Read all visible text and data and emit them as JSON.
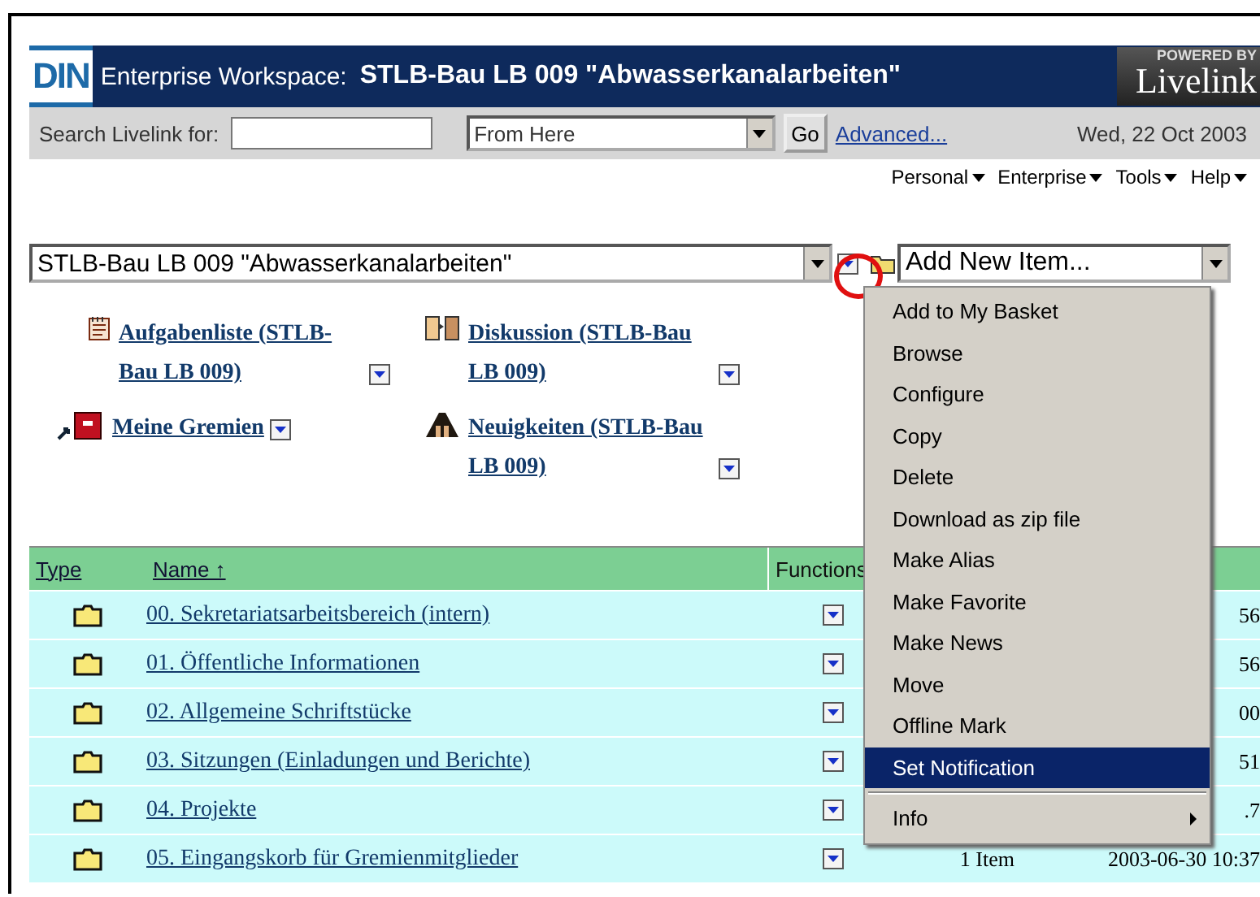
{
  "header": {
    "logo": "DIN",
    "label": "Enterprise Workspace:",
    "title": "STLB-Bau LB 009 \"Abwasserkanalarbeiten\"",
    "badge_top": "POWERED BY",
    "badge_main": "Livelink"
  },
  "search": {
    "label": "Search Livelink for:",
    "scope": "From Here",
    "go": "Go",
    "advanced": "Advanced...",
    "date": "Wed, 22 Oct 2003"
  },
  "menus": [
    "Personal",
    "Enterprise",
    "Tools",
    "Help"
  ],
  "location": {
    "value": "STLB-Bau LB 009 \"Abwasserkanalarbeiten\"",
    "add_item": "Add New Item..."
  },
  "links": [
    {
      "kind": "tasks",
      "text": "Aufgabenliste (STLB-Bau LB 009)"
    },
    {
      "kind": "discussion",
      "text": "Diskussion (STLB-Bau LB 009)"
    },
    {
      "kind": "alias",
      "text": "Meine Gremien"
    },
    {
      "kind": "news",
      "text": "Neuigkeiten (STLB-Bau LB 009)"
    }
  ],
  "table": {
    "columns": [
      {
        "label": "Type",
        "link": true
      },
      {
        "label": "Name ↑",
        "link": true
      },
      {
        "label": "Functions",
        "link": false
      }
    ],
    "rows": [
      {
        "name": "00. Sekretariatsarbeitsbereich (intern)",
        "size": "",
        "modified": "56"
      },
      {
        "name": "01. Öffentliche Informationen",
        "size": "",
        "modified": "56"
      },
      {
        "name": "02. Allgemeine Schriftstücke",
        "size": "",
        "modified": "00"
      },
      {
        "name": "03. Sitzungen (Einladungen und Berichte)",
        "size": "",
        "modified": "51"
      },
      {
        "name": "04. Projekte",
        "size": "",
        "modified": ".7"
      },
      {
        "name": "05. Eingangskorb für Gremienmitglieder",
        "size": "1 Item",
        "modified": "2003-06-30 10:37"
      }
    ]
  },
  "context_menu": [
    {
      "label": "Add to My Basket",
      "kind": "item",
      "selected": false
    },
    {
      "label": "Browse",
      "kind": "item",
      "selected": false
    },
    {
      "label": "Configure",
      "kind": "item",
      "selected": false
    },
    {
      "label": "Copy",
      "kind": "item",
      "selected": false
    },
    {
      "label": "Delete",
      "kind": "item",
      "selected": false
    },
    {
      "label": "Download as zip file",
      "kind": "item",
      "selected": false
    },
    {
      "label": "Make Alias",
      "kind": "item",
      "selected": false
    },
    {
      "label": "Make Favorite",
      "kind": "item",
      "selected": false
    },
    {
      "label": "Make News",
      "kind": "item",
      "selected": false
    },
    {
      "label": "Move",
      "kind": "item",
      "selected": false
    },
    {
      "label": "Offline Mark",
      "kind": "item",
      "selected": false
    },
    {
      "label": "Set Notification",
      "kind": "item",
      "selected": true
    },
    {
      "label": "Info",
      "kind": "submenu",
      "selected": false
    }
  ]
}
